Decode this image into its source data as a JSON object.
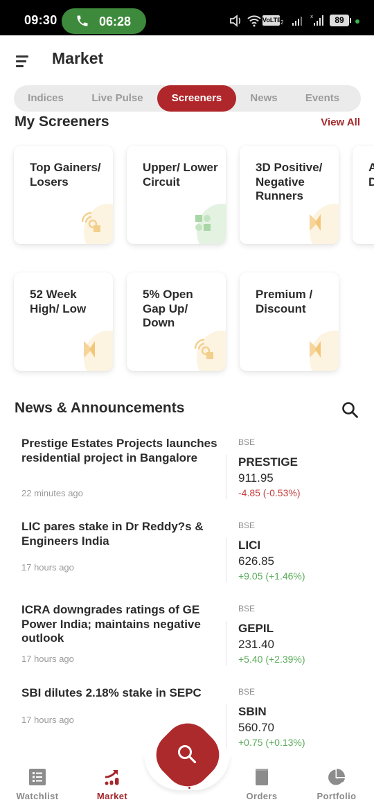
{
  "status_bar": {
    "time": "09:30",
    "call_duration": "06:28",
    "network_badge": "VoLTE",
    "network_badge_sub": "2",
    "battery": "89"
  },
  "header": {
    "title": "Market"
  },
  "tabs": [
    {
      "label": "Indices",
      "active": false
    },
    {
      "label": "Live Pulse",
      "active": false
    },
    {
      "label": "Screeners",
      "active": true
    },
    {
      "label": "News",
      "active": false
    },
    {
      "label": "Events",
      "active": false
    }
  ],
  "screeners": {
    "title": "My Screeners",
    "view_all": "View All",
    "cards": [
      {
        "label": "Top Gainers/ Losers",
        "icon": "radar-icon",
        "accent": "#f6c26b"
      },
      {
        "label": "Upper/ Lower Circuit",
        "icon": "grid-shapes-icon",
        "accent": "#7cc27c"
      },
      {
        "label": "3D Positive/ Negative Runners",
        "icon": "bowtie-icon",
        "accent": "#f6c26b"
      },
      {
        "label": "A D",
        "icon": "",
        "accent": "#f6c26b"
      },
      {
        "label": "52 Week High/ Low",
        "icon": "bowtie-icon",
        "accent": "#f6c26b"
      },
      {
        "label": "5% Open Gap Up/ Down",
        "icon": "radar-icon",
        "accent": "#f6c26b"
      },
      {
        "label": "Premium / Discount",
        "icon": "bowtie-icon",
        "accent": "#f6c26b"
      }
    ]
  },
  "news": {
    "title": "News & Announcements",
    "items": [
      {
        "headline": "Prestige Estates Projects launches residential project in Bangalore",
        "time": "22 minutes ago",
        "exchange": "BSE",
        "symbol": "PRESTIGE",
        "price": "911.95",
        "change": "-4.85 (-0.53%)",
        "direction": "down"
      },
      {
        "headline": "LIC pares stake in Dr Reddy?s & Engineers India",
        "time": "17 hours ago",
        "exchange": "BSE",
        "symbol": "LICI",
        "price": "626.85",
        "change": "+9.05 (+1.46%)",
        "direction": "up"
      },
      {
        "headline": "ICRA downgrades ratings of GE Power India; maintains negative outlook",
        "time": "17 hours ago",
        "exchange": "BSE",
        "symbol": "GEPIL",
        "price": "231.40",
        "change": "+5.40 (+2.39%)",
        "direction": "up"
      },
      {
        "headline": "SBI dilutes 2.18% stake in SEPC",
        "time": "17 hours ago",
        "exchange": "BSE",
        "symbol": "SBIN",
        "price": "560.70",
        "change": "+0.75 (+0.13%)",
        "direction": "up"
      }
    ]
  },
  "bottom_nav": [
    {
      "label": "Watchlist",
      "icon": "list-icon",
      "active": false
    },
    {
      "label": "Market",
      "icon": "trend-chart-icon",
      "active": true
    },
    {
      "label": "",
      "icon": "search-icon",
      "active": false
    },
    {
      "label": "Orders",
      "icon": "book-icon",
      "active": false
    },
    {
      "label": "Portfolio",
      "icon": "pie-chart-icon",
      "active": false
    }
  ],
  "colors": {
    "brand": "#ad2a2c",
    "positive": "#5aaa5a",
    "negative": "#c0403f",
    "call_pill": "#3e8a3c"
  }
}
